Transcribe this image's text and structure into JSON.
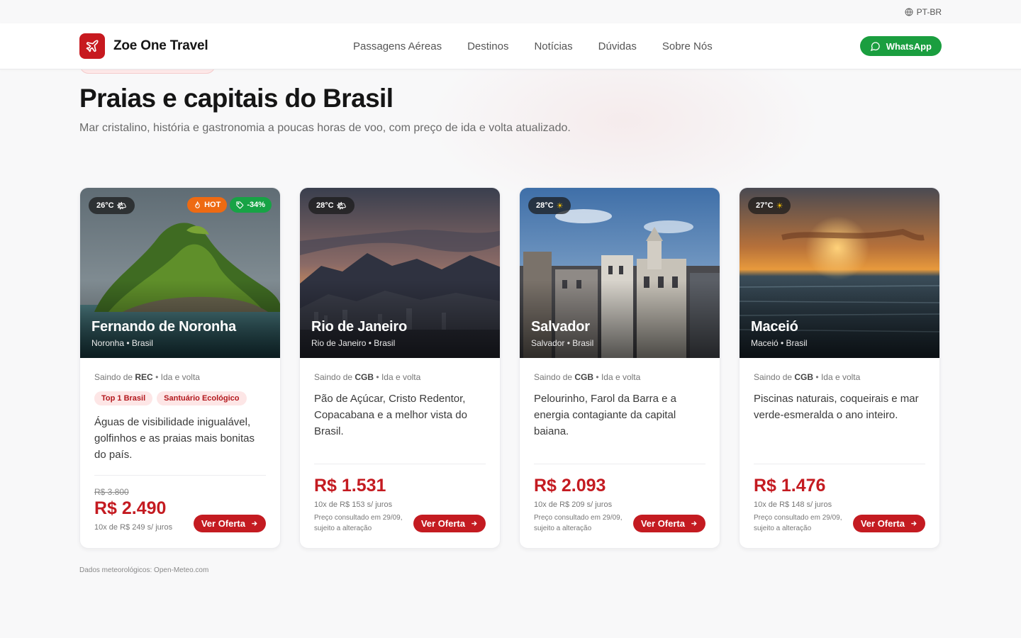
{
  "topbar": {
    "language": "PT-BR"
  },
  "header": {
    "brand": "Zoe One Travel",
    "nav": [
      "Passagens Aéreas",
      "Destinos",
      "Notícias",
      "Dúvidas",
      "Sobre Nós"
    ],
    "whatsapp": "WhatsApp"
  },
  "section": {
    "title": "Praias e capitais do Brasil",
    "subtitle": "Mar cristalino, história e gastronomia a poucas horas de voo, com preço de ida e volta atualizado."
  },
  "cards": [
    {
      "temp": "26°C",
      "weather_icon": "sun-cloud-icon",
      "hot": "HOT",
      "discount": "-34%",
      "city": "Fernando de Noronha",
      "region": "Noronha • Brasil",
      "origin_label": "Saindo de",
      "origin": "REC",
      "trip": "• Ida e volta",
      "tags": [
        "Top 1 Brasil",
        "Santuário Ecológico"
      ],
      "description": "Águas de visibilidade inigualável, golfinhos e as praias mais bonitas do país.",
      "old_price": "R$ 3.800",
      "price": "R$ 2.490",
      "installments": "10x de R$ 249 s/ juros",
      "note": "",
      "cta": "Ver Oferta"
    },
    {
      "temp": "28°C",
      "weather_icon": "sun-cloud-icon",
      "city": "Rio de Janeiro",
      "region": "Rio de Janeiro • Brasil",
      "origin_label": "Saindo de",
      "origin": "CGB",
      "trip": "• Ida e volta",
      "description": "Pão de Açúcar, Cristo Redentor, Copacabana e a melhor vista do Brasil.",
      "price": "R$ 1.531",
      "installments": "10x de R$ 153 s/ juros",
      "note": "Preço consultado em 29/09, sujeito a alteração",
      "cta": "Ver Oferta"
    },
    {
      "temp": "28°C",
      "weather_icon": "sun-icon",
      "city": "Salvador",
      "region": "Salvador • Brasil",
      "origin_label": "Saindo de",
      "origin": "CGB",
      "trip": "• Ida e volta",
      "description": "Pelourinho, Farol da Barra e a energia contagiante da capital baiana.",
      "price": "R$ 2.093",
      "installments": "10x de R$ 209 s/ juros",
      "note": "Preço consultado em 29/09, sujeito a alteração",
      "cta": "Ver Oferta"
    },
    {
      "temp": "27°C",
      "weather_icon": "sun-icon",
      "city": "Maceió",
      "region": "Maceió • Brasil",
      "origin_label": "Saindo de",
      "origin": "CGB",
      "trip": "• Ida e volta",
      "description": "Piscinas naturais, coqueirais e mar verde-esmeralda o ano inteiro.",
      "price": "R$ 1.476",
      "installments": "10x de R$ 148 s/ juros",
      "note": "Preço consultado em 29/09, sujeito a alteração",
      "cta": "Ver Oferta"
    }
  ],
  "footnote": "Dados meteorológicos: Open-Meteo.com",
  "colors": {
    "brand": "#c7191f",
    "price": "#c41b21",
    "whatsapp": "#1a9e3f",
    "hot": "#ee6a12",
    "discount": "#17a345"
  }
}
